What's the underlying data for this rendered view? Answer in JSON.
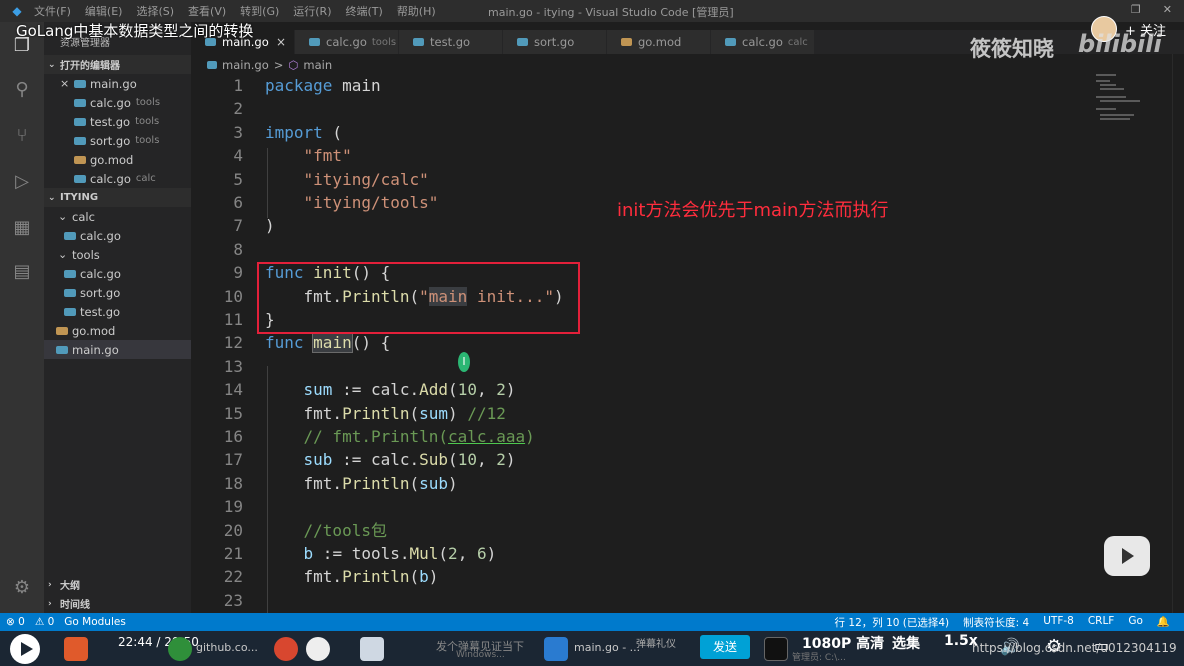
{
  "window": {
    "menu": [
      "文件(F)",
      "编辑(E)",
      "选择(S)",
      "查看(V)",
      "转到(G)",
      "运行(R)",
      "终端(T)",
      "帮助(H)"
    ],
    "title": "main.go - itying - Visual Studio Code [管理员]"
  },
  "video": {
    "title": "GoLang中基本数据类型之间的转换",
    "follow_label": "+ 关注",
    "uploader": "筱筱知晓",
    "platform_logo": "bilibili",
    "annotation": "init方法会优先于main方法而执行",
    "current_time": "22:44",
    "separator": "/",
    "total_time": "29:50",
    "send_label": "发送",
    "quality": "1080P 高清",
    "select_label": "选集",
    "speed": "1.5x",
    "danmaku_placeholder": "发个弹幕见证当下",
    "blog_url": "https://blog.csdn.net/u012304119"
  },
  "sidebar": {
    "title": "资源管理器",
    "open_editors_label": "打开的编辑器",
    "open_editors": [
      {
        "name": "main.go",
        "hint": "",
        "close": "×"
      },
      {
        "name": "calc.go",
        "hint": "tools"
      },
      {
        "name": "test.go",
        "hint": "tools"
      },
      {
        "name": "sort.go",
        "hint": "tools"
      },
      {
        "name": "go.mod",
        "hint": ""
      },
      {
        "name": "calc.go",
        "hint": "calc"
      }
    ],
    "project_label": "ITYING",
    "tree": {
      "calc_folder": "calc",
      "calc_file": "calc.go",
      "tools_folder": "tools",
      "tools_calc": "calc.go",
      "tools_sort": "sort.go",
      "tools_test": "test.go",
      "gomod": "go.mod",
      "maingo": "main.go"
    },
    "outline_label": "大纲",
    "timeline_label": "时间线"
  },
  "tabs": [
    {
      "name": "main.go",
      "hint": "",
      "active": true
    },
    {
      "name": "calc.go",
      "hint": "tools"
    },
    {
      "name": "test.go",
      "hint": ""
    },
    {
      "name": "sort.go",
      "hint": ""
    },
    {
      "name": "go.mod",
      "hint": ""
    },
    {
      "name": "calc.go",
      "hint": "calc"
    }
  ],
  "breadcrumb": {
    "file": "main.go",
    "sep": ">",
    "symbol": "main"
  },
  "editor": {
    "line_numbers": [
      "1",
      "2",
      "3",
      "4",
      "5",
      "6",
      "7",
      "8",
      "9",
      "10",
      "11",
      "12",
      "13",
      "14",
      "15",
      "16",
      "17",
      "18",
      "19",
      "20",
      "21",
      "22",
      "23"
    ],
    "l1_kw": "package",
    "l1_name": "main",
    "l3_kw": "import",
    "l3_paren": " (",
    "l4": "\"fmt\"",
    "l5": "\"itying/calc\"",
    "l6": "\"itying/tools\"",
    "l7": ")",
    "l9_kw": "func",
    "l9_fn": "init",
    "l9_rest": "() {",
    "l10_pkg": "fmt.",
    "l10_fn": "Println",
    "l10_open": "(",
    "l10_str_q": "\"",
    "l10_str_hl": "main",
    "l10_str_rest": " init...\"",
    "l10_close": ")",
    "l11": "}",
    "l12_kw": "func",
    "l12_fn": "main",
    "l12_rest": "() {",
    "l14_var": "sum",
    "l14_op": " := calc.",
    "l14_fn": "Add",
    "l14_open": "(",
    "l14_a": "10",
    "l14_comma": ", ",
    "l14_b": "2",
    "l14_close": ")",
    "l15_pkg": "fmt.",
    "l15_fn": "Println",
    "l15_open": "(",
    "l15_var": "sum",
    "l15_close": ") ",
    "l15_cm": "//12",
    "l16_cm": "// fmt.Println(",
    "l16_sq": "calc.aaa",
    "l16_end": ")",
    "l17_var": "sub",
    "l17_op": " := calc.",
    "l17_fn": "Sub",
    "l17_open": "(",
    "l17_a": "10",
    "l17_comma": ", ",
    "l17_b": "2",
    "l17_close": ")",
    "l18_pkg": "fmt.",
    "l18_fn": "Println",
    "l18_open": "(",
    "l18_var": "sub",
    "l18_close": ")",
    "l20_cm": "//tools包",
    "l21_var": "b",
    "l21_op": " := tools.",
    "l21_fn": "Mul",
    "l21_open": "(",
    "l21_a": "2",
    "l21_comma": ", ",
    "l21_b": "6",
    "l21_close": ")",
    "l22_pkg": "fmt.",
    "l22_fn": "Println",
    "l22_open": "(",
    "l22_var": "b",
    "l22_close": ")"
  },
  "statusbar": {
    "errors": "⊗ 0",
    "warnings": "⚠ 0",
    "go_modules": "Go Modules",
    "position": "行 12，列 10 (已选择4)",
    "tab_size": "制表符长度: 4",
    "encoding": "UTF-8",
    "eol": "CRLF",
    "language": "Go"
  },
  "taskbar": {
    "github_label": "github.co...",
    "windows_label": "Windows...",
    "maingo_label": "main.go - ...",
    "danmaku_label": "弹幕礼仪",
    "admin_label": "管理员: C:\\..."
  },
  "colors": {
    "accent": "#007acc",
    "annotation_red": "#ff2d3d",
    "box_red": "#e3203a"
  }
}
